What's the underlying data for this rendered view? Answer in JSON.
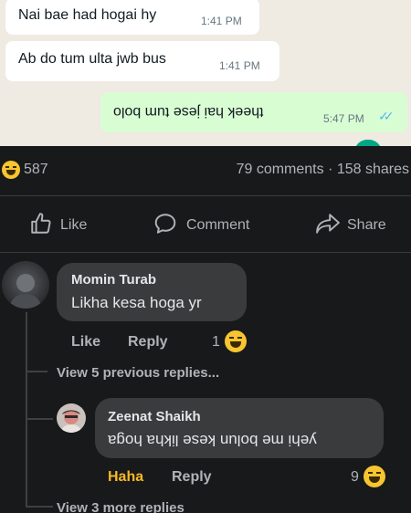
{
  "chat": {
    "messages": [
      {
        "text": "Nai bae had hogai hy",
        "time": "1:41 PM"
      },
      {
        "text": "Ab do tum ulta jwb bus",
        "time": "1:41 PM"
      },
      {
        "text": "theek hai jese tum bolo",
        "time": "5:47 PM",
        "read_ticks": "✓✓"
      }
    ]
  },
  "post": {
    "reaction_count": "587",
    "stats": "79 comments · 158 shares",
    "actions": {
      "like": "Like",
      "comment": "Comment",
      "share": "Share"
    }
  },
  "comments": [
    {
      "author": "Momin Turab",
      "text": "Likha kesa hoga yr",
      "like_label": "Like",
      "reply_label": "Reply",
      "reaction_count": "1",
      "view_replies": "View 5 previous replies..."
    },
    {
      "author": "Zeenat Shaikh",
      "text": "yehi me bolun kese likha hoga",
      "reaction_label": "Haha",
      "reply_label": "Reply",
      "reaction_count": "9",
      "view_replies": "View 3 more replies"
    }
  ],
  "colors": {
    "chat_bg": "#efeae2",
    "outgoing_bubble": "#d9fdd3",
    "fb_bg": "#18191a",
    "comment_bg": "#3a3b3c",
    "haha": "#f7b928",
    "read_tick": "#53bdeb"
  }
}
